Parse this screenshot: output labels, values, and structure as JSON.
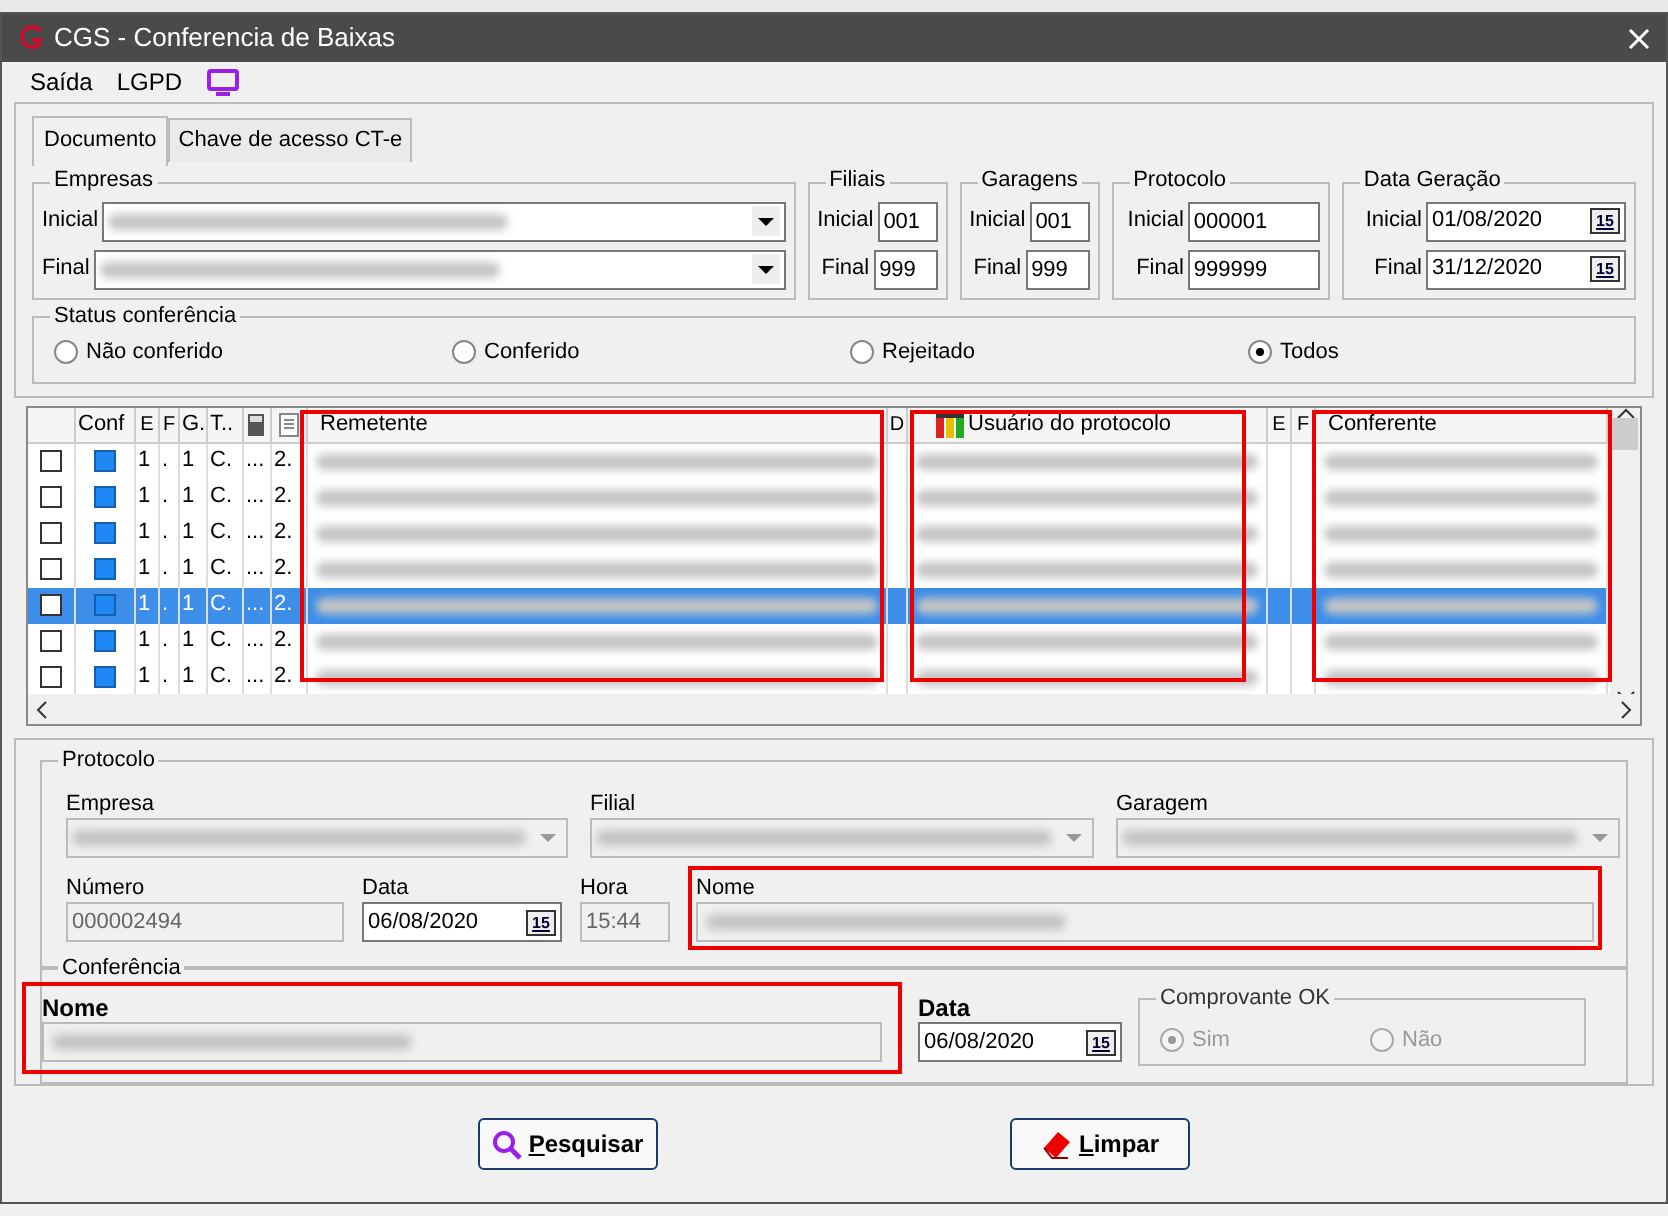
{
  "window": {
    "title": "CGS - Conferencia de Baixas"
  },
  "menu": [
    {
      "label": "Saída"
    },
    {
      "label": "LGPD"
    }
  ],
  "tabs": [
    {
      "label": "Documento",
      "selected": true
    },
    {
      "label": "Chave de acesso CT-e",
      "selected": false
    }
  ],
  "range_groups": [
    {
      "title": "Empresas",
      "kind": "combo",
      "rows": [
        {
          "label": "Inicial"
        },
        {
          "label": "Final"
        }
      ]
    },
    {
      "title": "Filiais",
      "kind": "text",
      "rows": [
        {
          "label": "Inicial",
          "value": "001"
        },
        {
          "label": "Final",
          "value": "999"
        }
      ]
    },
    {
      "title": "Garagens",
      "kind": "text",
      "rows": [
        {
          "label": "Inicial",
          "value": "001"
        },
        {
          "label": "Final",
          "value": "999"
        }
      ]
    },
    {
      "title": "Protocolo",
      "kind": "text",
      "rows": [
        {
          "label": "Inicial",
          "value": "000001"
        },
        {
          "label": "Final",
          "value": "999999"
        }
      ]
    },
    {
      "title": "Data Geração",
      "kind": "date",
      "rows": [
        {
          "label": "Inicial",
          "value": "01/08/2020",
          "button": "15"
        },
        {
          "label": "Final",
          "value": "31/12/2020",
          "button": "15"
        }
      ]
    }
  ],
  "status": {
    "title": "Status conferência",
    "options": [
      {
        "label": "Não conferido",
        "selected": false
      },
      {
        "label": "Conferido",
        "selected": false
      },
      {
        "label": "Rejeitado",
        "selected": false
      },
      {
        "label": "Todos",
        "selected": true
      }
    ]
  },
  "grid": {
    "columns": [
      {
        "kind": "blank"
      },
      {
        "kind": "text",
        "label": "Conf"
      },
      {
        "kind": "text",
        "label": "E"
      },
      {
        "kind": "text",
        "label": "F"
      },
      {
        "kind": "text",
        "label": "G."
      },
      {
        "kind": "text",
        "label": "T.."
      },
      {
        "kind": "icon"
      },
      {
        "kind": "icon"
      },
      {
        "kind": "text",
        "label": "Remetente"
      },
      {
        "kind": "text",
        "label": "D"
      },
      {
        "kind": "icon_text",
        "label": "Usuário do protocolo"
      },
      {
        "kind": "text",
        "label": "E"
      },
      {
        "kind": "text",
        "label": "F"
      },
      {
        "kind": "text",
        "label": "Conferente"
      }
    ],
    "rows": [
      {
        "selected": false,
        "checked": false,
        "cells": [
          "",
          "",
          "1",
          ".",
          "1",
          "C.",
          "...",
          "2."
        ]
      },
      {
        "selected": false,
        "checked": false,
        "cells": [
          "",
          "",
          "1",
          ".",
          "1",
          "C.",
          "...",
          "2."
        ]
      },
      {
        "selected": false,
        "checked": false,
        "cells": [
          "",
          "",
          "1",
          ".",
          "1",
          "C.",
          "...",
          "2."
        ]
      },
      {
        "selected": false,
        "checked": false,
        "cells": [
          "",
          "",
          "1",
          ".",
          "1",
          "C.",
          "...",
          "2."
        ]
      },
      {
        "selected": true,
        "checked": false,
        "cells": [
          "",
          "",
          "1",
          ".",
          "1",
          "C.",
          "...",
          "2."
        ]
      },
      {
        "selected": false,
        "checked": false,
        "cells": [
          "",
          "",
          "1",
          ".",
          "1",
          "C.",
          "...",
          "2."
        ]
      },
      {
        "selected": false,
        "checked": false,
        "cells": [
          "",
          "",
          "1",
          ".",
          "1",
          "C.",
          "...",
          "2."
        ]
      }
    ]
  },
  "protocolo": {
    "title": "Protocolo",
    "empresa_label": "Empresa",
    "filial_label": "Filial",
    "garagem_label": "Garagem",
    "numero_label": "Número",
    "numero": "000002494",
    "data_label": "Data",
    "data": "06/08/2020",
    "data_button": "15",
    "hora_label": "Hora",
    "hora": "15:44",
    "nome_label": "Nome"
  },
  "conferencia": {
    "title": "Conferência",
    "nome_label": "Nome",
    "data_label": "Data",
    "data": "06/08/2020",
    "data_button": "15",
    "comprovante": {
      "title": "Comprovante OK",
      "disabled": true,
      "options": [
        {
          "label": "Sim",
          "selected": true
        },
        {
          "label": "Não",
          "selected": false
        }
      ]
    }
  },
  "buttons": [
    {
      "label": "Pesquisar",
      "kind": "search"
    },
    {
      "label": "Limpar",
      "kind": "clear"
    }
  ]
}
